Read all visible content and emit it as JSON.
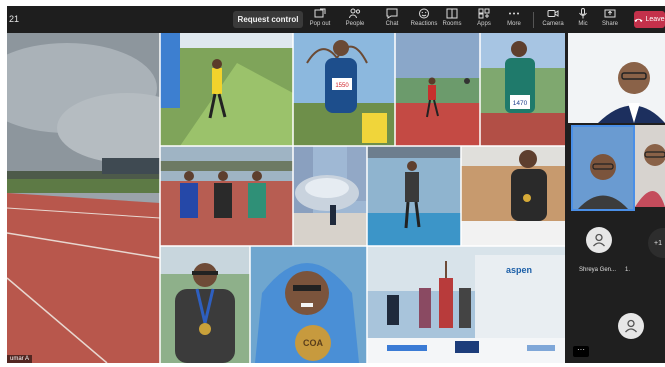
{
  "toolbar": {
    "timer": "21",
    "request_control": "Request control",
    "items": [
      {
        "label": "Pop out",
        "icon": "popout-icon"
      },
      {
        "label": "People",
        "icon": "people-icon"
      },
      {
        "label": "Chat",
        "icon": "chat-icon"
      },
      {
        "label": "Reactions",
        "icon": "reactions-icon"
      },
      {
        "label": "Rooms",
        "icon": "rooms-icon"
      },
      {
        "label": "Apps",
        "icon": "apps-icon"
      },
      {
        "label": "More",
        "icon": "more-icon"
      },
      {
        "label": "Camera",
        "icon": "camera-icon"
      },
      {
        "label": "Mic",
        "icon": "mic-icon"
      },
      {
        "label": "Share",
        "icon": "share-icon"
      }
    ],
    "leave_label": "Leave"
  },
  "stage": {
    "presenter_name": "umar A",
    "bib_numbers": [
      "1550",
      "1470"
    ],
    "medal_text": "COA",
    "banner_text": "aspen"
  },
  "rail": {
    "participant_name": "Shreya Gen...",
    "participant_status": "1.",
    "overflow_count": "+1"
  },
  "colors": {
    "toolbar_bg": "#1e1e1e",
    "leave_red": "#c4314b",
    "active_border": "#4a8fe7",
    "track_red": "#b8574c"
  }
}
